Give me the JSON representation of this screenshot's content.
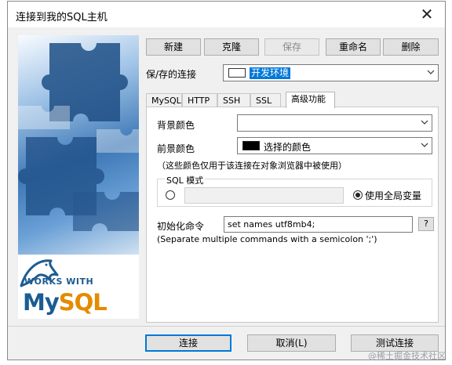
{
  "window": {
    "title": "连接到我的SQL主机",
    "close_glyph": "✕"
  },
  "toolbar": {
    "new_label": "新建",
    "clone_label": "克隆",
    "save_label": "保存",
    "rename_label": "重命名",
    "delete_label": "删除"
  },
  "saved_connection": {
    "label": "保/存的连接",
    "value": "开发环境"
  },
  "tabs": [
    {
      "label": "MySQL"
    },
    {
      "label": "HTTP"
    },
    {
      "label": "SSH"
    },
    {
      "label": "SSL"
    },
    {
      "label": "高级功能",
      "active": true
    }
  ],
  "advanced": {
    "bg_color_label": "背景颜色",
    "bg_color_value": "",
    "fg_color_label": "前景颜色",
    "fg_color_value": "选择的颜色",
    "fg_color_swatch": "#000000",
    "color_note": "（这些颜色仅用于该连接在对象浏览器中被使用）",
    "sql_mode_title": "SQL 模式",
    "sql_mode_custom_value": "",
    "sql_mode_global_label": "使用全局变量",
    "init_cmd_label": "初始化命令",
    "init_cmd_value": "set names utf8mb4;",
    "help_label": "?",
    "init_cmd_hint": "(Separate multiple commands with a semicolon ';')"
  },
  "branding": {
    "works_with": "WORKS WITH",
    "logo_my": "My",
    "logo_sql": "SQL"
  },
  "footer": {
    "connect_label": "连接",
    "cancel_label": "取消(L)",
    "test_label": "测试连接"
  },
  "watermark": "@稀土掘金技术社区",
  "colors": {
    "accent": "#0078d7",
    "mysql_blue": "#1b5c92",
    "mysql_orange": "#e48b00"
  }
}
